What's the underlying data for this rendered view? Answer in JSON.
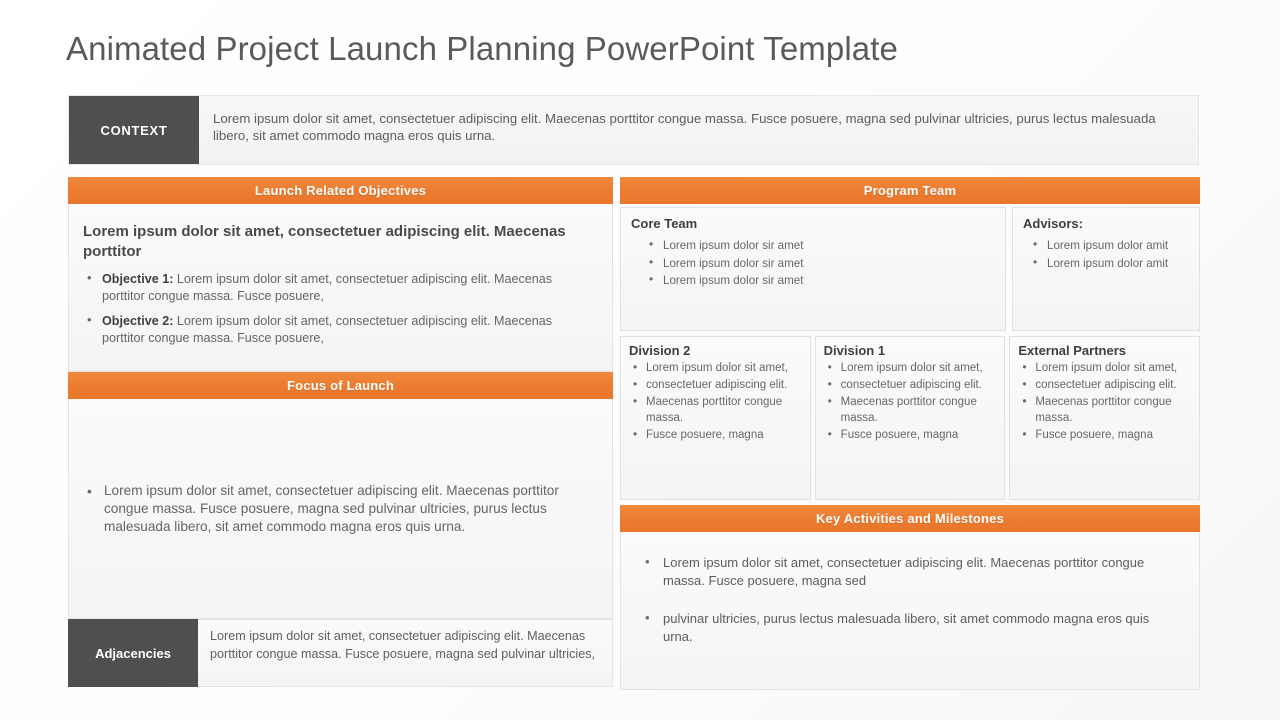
{
  "theme": {
    "accent_orange": "#ED7D31",
    "dark_gray": "#4F4F4F",
    "panel_bg": "#F7F7F7",
    "text_gray": "#5A5A5A"
  },
  "title": "Animated Project Launch Planning PowerPoint Template",
  "context": {
    "label": "CONTEXT",
    "text": "Lorem ipsum dolor sit amet, consectetuer adipiscing elit. Maecenas porttitor congue massa. Fusce posuere, magna sed pulvinar ultricies, purus lectus malesuada libero, sit amet commodo magna eros quis urna."
  },
  "left_column": {
    "objectives": {
      "header": "Launch Related Objectives",
      "lead": "Lorem ipsum dolor sit amet, consectetuer adipiscing elit. Maecenas porttitor",
      "items": [
        {
          "label": "Objective 1:",
          "text": " Lorem ipsum dolor sit amet, consectetuer adipiscing elit. Maecenas porttitor congue massa. Fusce posuere,"
        },
        {
          "label": "Objective 2:",
          "text": " Lorem ipsum dolor sit amet, consectetuer adipiscing elit. Maecenas porttitor congue massa. Fusce posuere,"
        }
      ]
    },
    "focus": {
      "header": "Focus of Launch",
      "items": [
        "Lorem ipsum dolor sit amet, consectetuer adipiscing elit. Maecenas porttitor congue massa. Fusce posuere, magna sed pulvinar ultricies, purus lectus malesuada libero, sit amet commodo magna eros quis urna."
      ]
    },
    "adjacencies": {
      "label": "Adjacencies",
      "text": "Lorem ipsum dolor sit amet, consectetuer adipiscing elit. Maecenas porttitor congue massa. Fusce posuere, magna sed pulvinar ultricies,"
    }
  },
  "right_column": {
    "program_team": {
      "header": "Program Team",
      "core_team": {
        "title": "Core Team",
        "items": [
          "Lorem ipsum dolor sir amet",
          "Lorem ipsum dolor sir amet",
          "Lorem ipsum dolor sir amet"
        ]
      },
      "advisors": {
        "title": "Advisors:",
        "items": [
          "Lorem ipsum dolor amit",
          "Lorem ipsum dolor amit"
        ]
      },
      "division_2": {
        "title": "Division 2",
        "items": [
          "Lorem ipsum dolor  sit amet,",
          "consectetuer adipiscing elit.",
          "Maecenas porttitor congue massa.",
          "Fusce posuere,  magna"
        ]
      },
      "division_1": {
        "title": "Division 1",
        "items": [
          "Lorem ipsum dolor  sit amet,",
          "consectetuer adipiscing elit.",
          "Maecenas porttitor congue massa.",
          "Fusce posuere,  magna"
        ]
      },
      "external_partners": {
        "title": "External Partners",
        "items": [
          "Lorem ipsum dolor  sit amet,",
          "consectetuer adipiscing elit.",
          "Maecenas porttitor congue massa.",
          "Fusce posuere,  magna"
        ]
      }
    },
    "key_activities": {
      "header": "Key Activities and Milestones",
      "items": [
        "Lorem ipsum dolor sit amet, consectetuer adipiscing elit. Maecenas porttitor congue massa. Fusce posuere, magna sed",
        "pulvinar ultricies, purus lectus malesuada libero,  sit amet commodo magna eros quis urna."
      ]
    }
  }
}
